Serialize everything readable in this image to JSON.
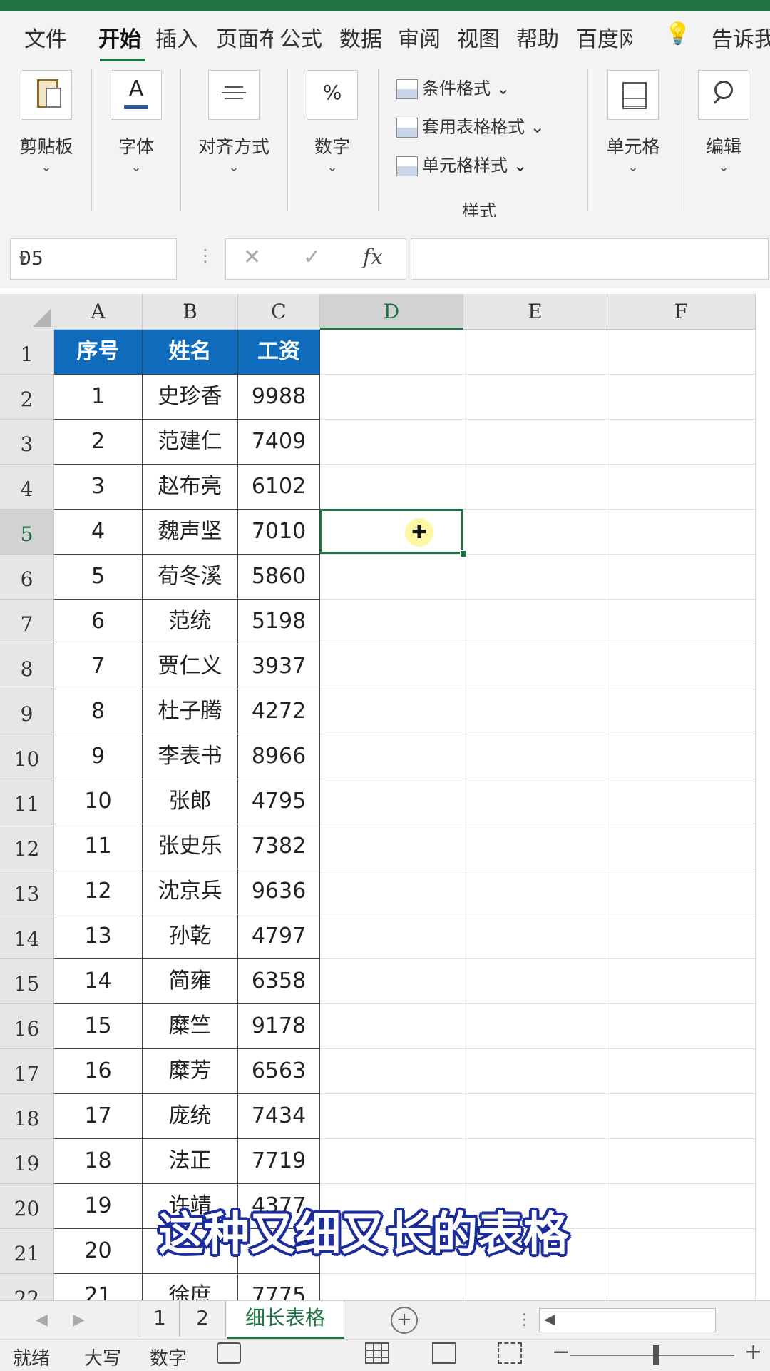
{
  "ribbon_tabs": [
    "文件",
    "开始",
    "插入",
    "页面布",
    "公式",
    "数据",
    "审阅",
    "视图",
    "帮助",
    "百度网",
    "告诉我"
  ],
  "ribbon": {
    "clipboard": "剪贴板",
    "font": "字体",
    "font_icon": "A",
    "align": "对齐方式",
    "number": "数字",
    "number_icon": "%",
    "cond_format": "条件格式",
    "table_format": "套用表格格式",
    "cell_style": "单元格样式",
    "styles_group": "样式",
    "cells": "单元格",
    "editing": "编辑",
    "chevron": "⌄"
  },
  "formula_bar": {
    "name_box": "D5",
    "cancel": "✕",
    "enter": "✓",
    "fx": "fx",
    "value": ""
  },
  "columns": [
    "A",
    "B",
    "C",
    "D",
    "E",
    "F"
  ],
  "table": {
    "headers": [
      "序号",
      "姓名",
      "工资"
    ],
    "rows": [
      [
        "1",
        "史珍香",
        "9988"
      ],
      [
        "2",
        "范建仁",
        "7409"
      ],
      [
        "3",
        "赵布亮",
        "6102"
      ],
      [
        "4",
        "魏声坚",
        "7010"
      ],
      [
        "5",
        "荀冬溪",
        "5860"
      ],
      [
        "6",
        "范统",
        "5198"
      ],
      [
        "7",
        "贾仁义",
        "3937"
      ],
      [
        "8",
        "杜子腾",
        "4272"
      ],
      [
        "9",
        "李表书",
        "8966"
      ],
      [
        "10",
        "张郎",
        "4795"
      ],
      [
        "11",
        "张史乐",
        "7382"
      ],
      [
        "12",
        "沈京兵",
        "9636"
      ],
      [
        "13",
        "孙乾",
        "4797"
      ],
      [
        "14",
        "简雍",
        "6358"
      ],
      [
        "15",
        "糜竺",
        "9178"
      ],
      [
        "16",
        "糜芳",
        "6563"
      ],
      [
        "17",
        "庞统",
        "7434"
      ],
      [
        "18",
        "法正",
        "7719"
      ],
      [
        "19",
        "许靖",
        "4377"
      ],
      [
        "20",
        "",
        ""
      ],
      [
        "21",
        "徐庶",
        "7775"
      ]
    ]
  },
  "selected_cell": "D5",
  "caption": "这种又细又长的表格",
  "sheets": [
    "1",
    "2",
    "细长表格"
  ],
  "active_sheet": "细长表格",
  "status": {
    "ready": "就绪",
    "caps": "大写",
    "num": "数字"
  },
  "zoom_minus": "−",
  "zoom_plus": "+",
  "colors": {
    "excel_green": "#217346",
    "header_blue": "#0f6cbd"
  }
}
